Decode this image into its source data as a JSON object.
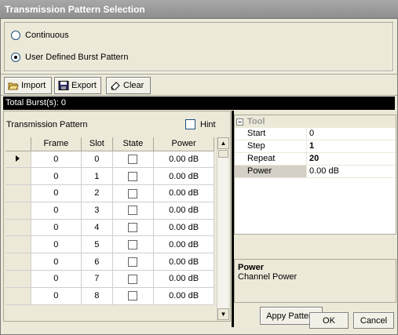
{
  "window": {
    "title": "Transmission Pattern Selection"
  },
  "mode": {
    "options": [
      {
        "label": "Continuous",
        "selected": false
      },
      {
        "label": "User Defined Burst Pattern",
        "selected": true
      }
    ]
  },
  "toolbar": {
    "import_label": "Import",
    "export_label": "Export",
    "clear_label": "Clear"
  },
  "status": {
    "total_bursts": "Total Burst(s): 0"
  },
  "pattern": {
    "label": "Transmission Pattern",
    "hint_label": "Hint",
    "hint_checked": false,
    "columns": [
      "Frame",
      "Slot",
      "State",
      "Power"
    ],
    "rows": [
      {
        "frame": "0",
        "slot": "0",
        "state": false,
        "power": "0.00 dB",
        "current": true
      },
      {
        "frame": "0",
        "slot": "1",
        "state": false,
        "power": "0.00 dB",
        "current": false
      },
      {
        "frame": "0",
        "slot": "2",
        "state": false,
        "power": "0.00 dB",
        "current": false
      },
      {
        "frame": "0",
        "slot": "3",
        "state": false,
        "power": "0.00 dB",
        "current": false
      },
      {
        "frame": "0",
        "slot": "4",
        "state": false,
        "power": "0.00 dB",
        "current": false
      },
      {
        "frame": "0",
        "slot": "5",
        "state": false,
        "power": "0.00 dB",
        "current": false
      },
      {
        "frame": "0",
        "slot": "6",
        "state": false,
        "power": "0.00 dB",
        "current": false
      },
      {
        "frame": "0",
        "slot": "7",
        "state": false,
        "power": "0.00 dB",
        "current": false
      },
      {
        "frame": "0",
        "slot": "8",
        "state": false,
        "power": "0.00 dB",
        "current": false
      }
    ]
  },
  "tool": {
    "category": "Tool",
    "properties": [
      {
        "key": "Start",
        "value": "0",
        "bold": false,
        "selected": false
      },
      {
        "key": "Step",
        "value": "1",
        "bold": true,
        "selected": false
      },
      {
        "key": "Repeat",
        "value": "20",
        "bold": true,
        "selected": false
      },
      {
        "key": "Power",
        "value": "0.00 dB",
        "bold": false,
        "selected": true
      }
    ],
    "description_title": "Power",
    "description_text": "Channel Power",
    "apply_label": "Appy Pattern"
  },
  "footer": {
    "ok_label": "OK",
    "cancel_label": "Cancel"
  },
  "icons": {
    "import": "folder-open-icon",
    "export": "floppy-disk-icon",
    "clear": "eraser-icon"
  }
}
